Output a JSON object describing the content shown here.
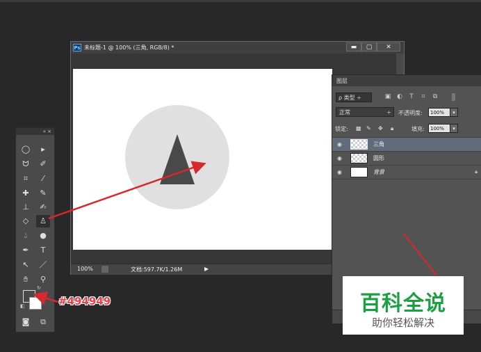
{
  "document": {
    "title": "未标题-1 @ 100% (三角, RGB/8) *",
    "app_badge": "Ps",
    "window_buttons": [
      "▬",
      "▢",
      "✕"
    ],
    "status": {
      "zoom": "100%",
      "doc_info": "文档:597.7K/1.26M",
      "arrow": "▶"
    }
  },
  "layers_panel": {
    "tab": "图层",
    "filter": "ρ 类型 ÷",
    "filter_icons": [
      "image-filter-icon",
      "adjustment-filter-icon",
      "type-filter-icon",
      "shape-filter-icon",
      "smart-object-filter-icon"
    ],
    "blend_mode": "正常",
    "opacity_label": "不透明度:",
    "opacity_value": "100%",
    "lock_label": "锁定:",
    "fill_label": "填充:",
    "fill_value": "100%",
    "layers": [
      {
        "name": "三角",
        "selected": true
      },
      {
        "name": "圆形",
        "selected": false
      },
      {
        "name": "背景",
        "selected": false,
        "locked": true
      }
    ]
  },
  "toolbox": {
    "header": "«  ×"
  },
  "annotation": {
    "color_hex": "#494949",
    "arrow_color": "#d9272e"
  },
  "canvas": {
    "circle_color": "#e0e0e0",
    "triangle_color": "#494949"
  },
  "watermark": {
    "title": "百科全说",
    "subtitle": "助你轻松解决"
  }
}
